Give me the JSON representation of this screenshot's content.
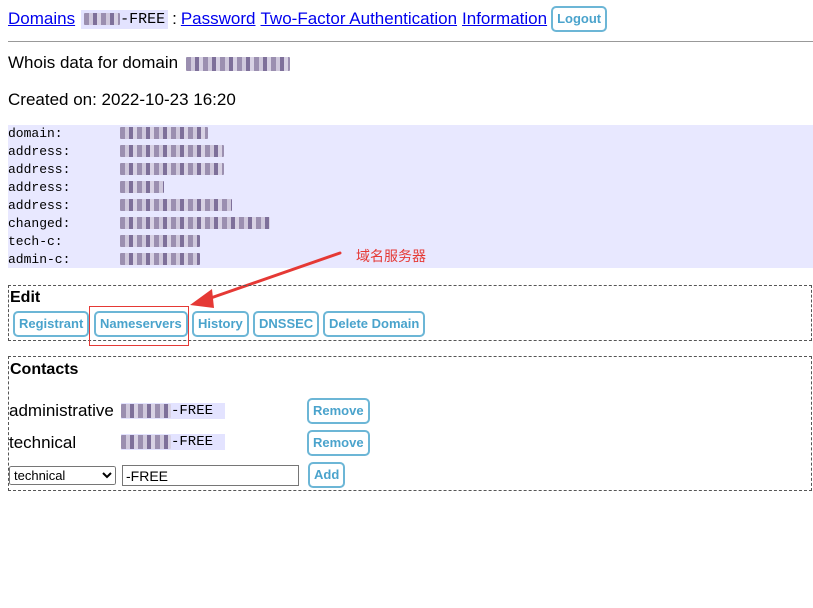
{
  "nav": {
    "domains": "Domains",
    "handle_suffix": "-FREE",
    "colon": ":",
    "password": "Password",
    "two_factor": "Two-Factor Authentication",
    "information": "Information",
    "logout": "Logout"
  },
  "page": {
    "whois_heading": "Whois data for domain",
    "created": "Created on: 2022-10-23 16:20"
  },
  "whois": {
    "keys": [
      "domain:",
      "address:",
      "address:",
      "address:",
      "address:",
      "changed:",
      "tech-c:",
      "admin-c:"
    ]
  },
  "annotation": {
    "text": "域名服务器",
    "color": "#e53935"
  },
  "edit": {
    "title": "Edit",
    "buttons": [
      "Registrant",
      "Nameservers",
      "History",
      "DNSSEC",
      "Delete Domain"
    ]
  },
  "contacts": {
    "title": "Contacts",
    "rows": [
      {
        "role": "administrative",
        "handle_suffix": "-FREE",
        "remove": "Remove"
      },
      {
        "role": "technical",
        "handle_suffix": "-FREE",
        "remove": "Remove"
      }
    ],
    "add_select_value": "technical",
    "add_input_value": "-FREE",
    "add_button": "Add"
  },
  "colors": {
    "link": "#0000ee",
    "button_border": "#6cb6d6",
    "button_text": "#4aa3cc",
    "whois_bg": "#e8e8ff",
    "handle_bg": "#e3e3ff"
  }
}
